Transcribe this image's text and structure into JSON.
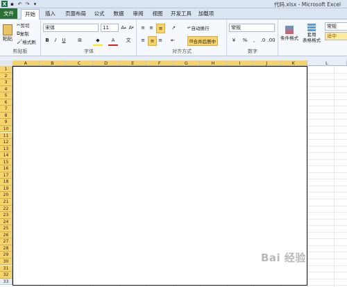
{
  "window": {
    "title": "代码.xlsx - Microsoft Excel"
  },
  "tabs": [
    "文件",
    "开始",
    "插入",
    "页面布局",
    "公式",
    "数据",
    "审阅",
    "视图",
    "开发工具",
    "加载项"
  ],
  "clipboard": {
    "paste": "粘贴",
    "cut": "剪切",
    "copy": "复制",
    "format_painter": "格式刷",
    "label": "剪贴板"
  },
  "font": {
    "name": "宋体",
    "size": "11",
    "label": "字体",
    "bold": "B",
    "italic": "I",
    "underline": "U"
  },
  "alignment": {
    "wrap": "自动换行",
    "merge": "合并后居中",
    "label": "对齐方式"
  },
  "number": {
    "format": "常规",
    "label": "数字",
    "percent": "%"
  },
  "styles": {
    "conditional": "条件格式",
    "table": "套用\n表格格式",
    "normal": "常规",
    "medium": "适中"
  },
  "columns": [
    "A",
    "B",
    "C",
    "D",
    "E",
    "F",
    "G",
    "H",
    "I",
    "J",
    "K",
    "L"
  ],
  "rows": [
    "1",
    "2",
    "3",
    "4",
    "5",
    "6",
    "7",
    "8",
    "9",
    "10",
    "11",
    "12",
    "13",
    "14",
    "15",
    "16",
    "17",
    "18",
    "19",
    "20",
    "21",
    "22",
    "23",
    "24",
    "25",
    "26",
    "27",
    "28",
    "29",
    "30",
    "31",
    "32",
    "33"
  ],
  "watermark": "Bai 经验"
}
